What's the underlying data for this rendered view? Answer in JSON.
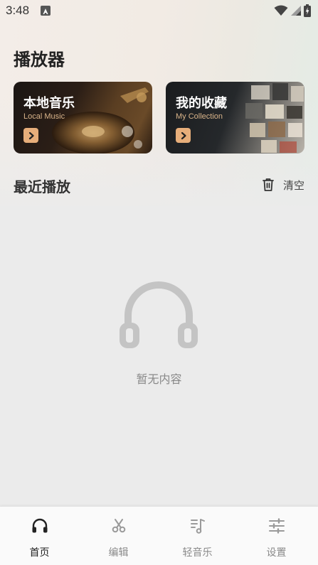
{
  "status_bar": {
    "time": "3:48"
  },
  "page": {
    "title": "播放器"
  },
  "cards": [
    {
      "title": "本地音乐",
      "subtitle": "Local Music"
    },
    {
      "title": "我的收藏",
      "subtitle": "My Collection"
    }
  ],
  "recent": {
    "title": "最近播放",
    "clear_label": "清空"
  },
  "empty": {
    "text": "暂无内容"
  },
  "nav": {
    "items": [
      {
        "label": "首页",
        "icon": "headphones-icon",
        "active": true
      },
      {
        "label": "编辑",
        "icon": "scissors-icon",
        "active": false
      },
      {
        "label": "轻音乐",
        "icon": "music-list-icon",
        "active": false
      },
      {
        "label": "设置",
        "icon": "sliders-icon",
        "active": false
      }
    ]
  },
  "colors": {
    "accent": "#e7ae7a",
    "text_dark": "#222222",
    "text_muted": "#8a8a8a"
  }
}
